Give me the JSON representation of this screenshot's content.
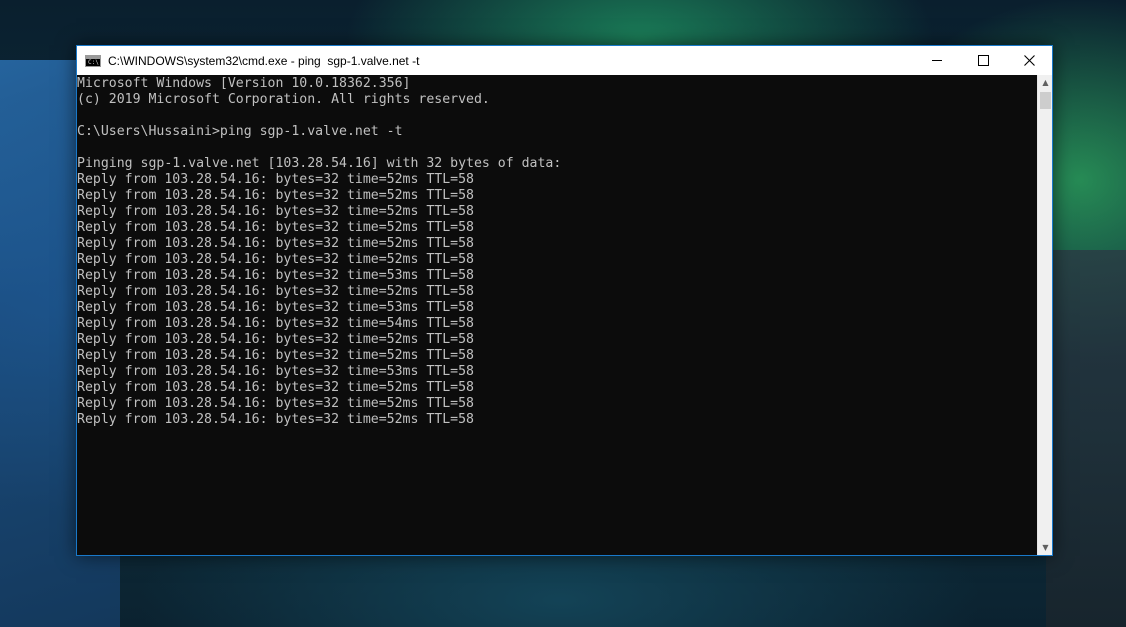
{
  "window": {
    "title": "C:\\WINDOWS\\system32\\cmd.exe - ping  sgp-1.valve.net -t",
    "app_icon_text": "C:\\",
    "controls": {
      "minimize_icon": "minimize-icon",
      "maximize_icon": "maximize-icon",
      "close_icon": "close-icon"
    },
    "accent_color": "#1979ca"
  },
  "console": {
    "background": "#0c0c0c",
    "foreground": "#c0c0c0",
    "lines": [
      "Microsoft Windows [Version 10.0.18362.356]",
      "(c) 2019 Microsoft Corporation. All rights reserved.",
      "",
      "C:\\Users\\Hussaini>ping sgp-1.valve.net -t",
      "",
      "Pinging sgp-1.valve.net [103.28.54.16] with 32 bytes of data:",
      "Reply from 103.28.54.16: bytes=32 time=52ms TTL=58",
      "Reply from 103.28.54.16: bytes=32 time=52ms TTL=58",
      "Reply from 103.28.54.16: bytes=32 time=52ms TTL=58",
      "Reply from 103.28.54.16: bytes=32 time=52ms TTL=58",
      "Reply from 103.28.54.16: bytes=32 time=52ms TTL=58",
      "Reply from 103.28.54.16: bytes=32 time=52ms TTL=58",
      "Reply from 103.28.54.16: bytes=32 time=53ms TTL=58",
      "Reply from 103.28.54.16: bytes=32 time=52ms TTL=58",
      "Reply from 103.28.54.16: bytes=32 time=53ms TTL=58",
      "Reply from 103.28.54.16: bytes=32 time=54ms TTL=58",
      "Reply from 103.28.54.16: bytes=32 time=52ms TTL=58",
      "Reply from 103.28.54.16: bytes=32 time=52ms TTL=58",
      "Reply from 103.28.54.16: bytes=32 time=53ms TTL=58",
      "Reply from 103.28.54.16: bytes=32 time=52ms TTL=58",
      "Reply from 103.28.54.16: bytes=32 time=52ms TTL=58",
      "Reply from 103.28.54.16: bytes=32 time=52ms TTL=58"
    ]
  },
  "scrollbar": {
    "up_icon": "scroll-up-arrow-icon",
    "down_icon": "scroll-down-arrow-icon",
    "up_glyph": "▲",
    "down_glyph": "▼"
  }
}
